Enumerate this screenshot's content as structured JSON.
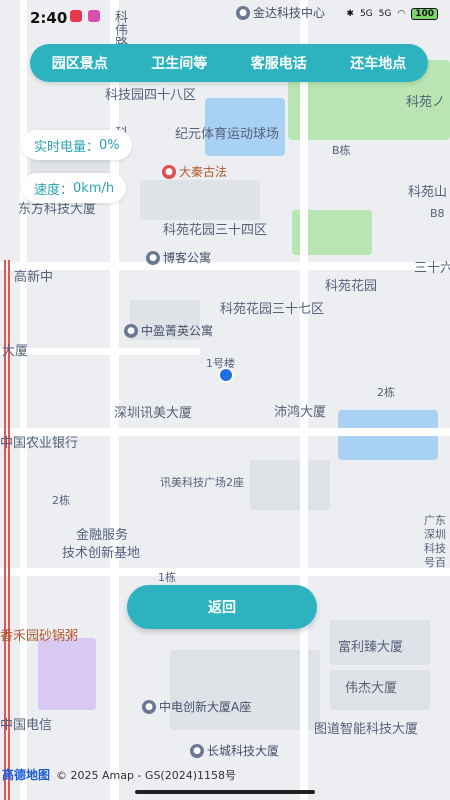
{
  "status_bar": {
    "time": "2:40",
    "network_a": "5G",
    "network_b": "5G",
    "battery": "100"
  },
  "tabs": [
    {
      "label": "园区景点"
    },
    {
      "label": "卫生间等"
    },
    {
      "label": "客服电话"
    },
    {
      "label": "还车地点"
    }
  ],
  "info": {
    "battery_label": "实时电量：",
    "battery_value": "0%",
    "speed_label": "速度：",
    "speed_value": "0km/h"
  },
  "map_labels": [
    "科技园四十八区",
    "纪元体育运动球场",
    "大秦古法",
    "东方科技大厦",
    "科苑花园三十四区",
    "博客公寓",
    "高新中",
    "科苑花园",
    "科苑花园三十七区",
    "中盈菁英公寓",
    "1号楼",
    "大厦",
    "深圳讯美大厦",
    "沛鸿大厦",
    "2栋",
    "中国农业银行",
    "讯美科技广场2座",
    "2栋",
    "金融服务",
    "技术创新基地",
    "1栋",
    "广东",
    "深圳",
    "科技",
    "号百",
    "香禾园砂锅粥",
    "富利臻大厦",
    "伟杰大厦",
    "中电创新大厦A座",
    "图道智能科技大厦",
    "中国电信",
    "长城科技大厦",
    "金达科技中心",
    "科苑ノ",
    "B栋",
    "科苑山",
    "B8",
    "三十六",
    "科伟路",
    "科路"
  ],
  "back_button": {
    "label": "返回"
  },
  "attribution": {
    "logo": "高德地图",
    "copyright": "© 2025 Amap - GS(2024)1158号"
  },
  "colors": {
    "accent": "#2db3c0",
    "location": "#1f6fe0"
  }
}
